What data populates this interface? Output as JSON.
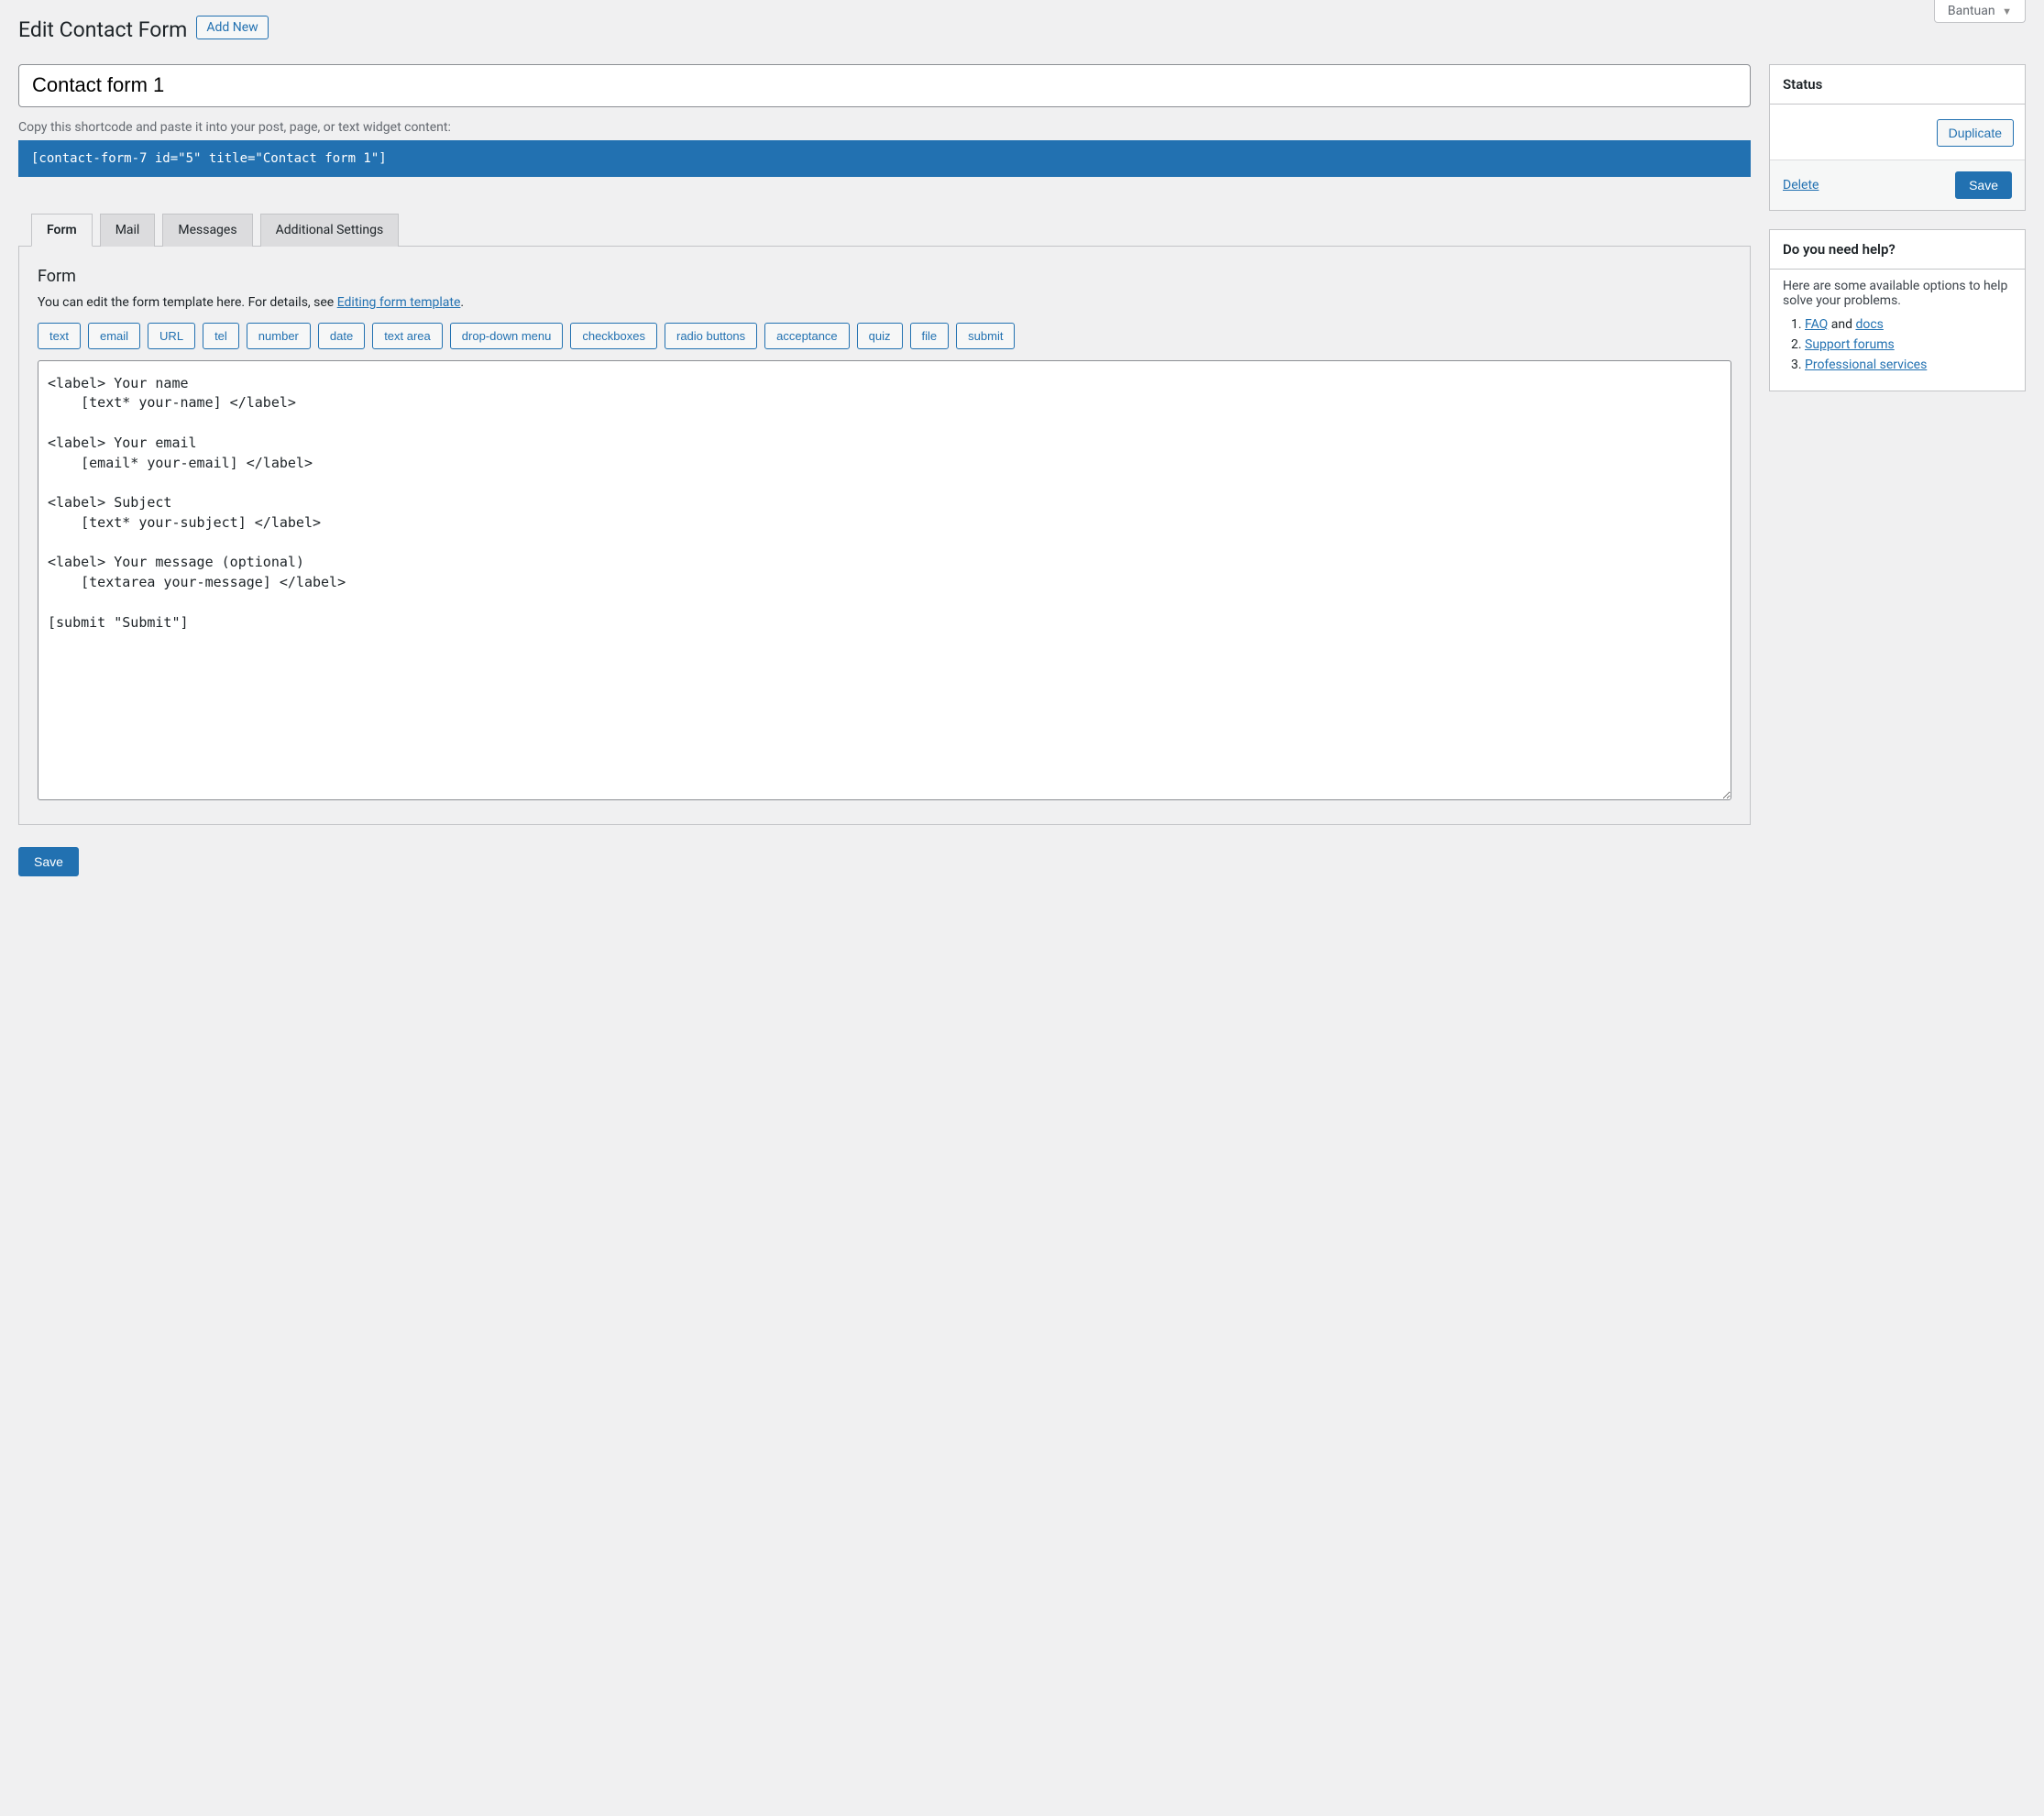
{
  "header": {
    "page_title": "Edit Contact Form",
    "add_new_label": "Add New",
    "help_toggle": "Bantuan"
  },
  "main": {
    "title_value": "Contact form 1",
    "shortcode_hint": "Copy this shortcode and paste it into your post, page, or text widget content:",
    "shortcode_value": "[contact-form-7 id=\"5\" title=\"Contact form 1\"]",
    "tabs": [
      {
        "label": "Form",
        "active": true
      },
      {
        "label": "Mail",
        "active": false
      },
      {
        "label": "Messages",
        "active": false
      },
      {
        "label": "Additional Settings",
        "active": false
      }
    ],
    "form_panel": {
      "heading": "Form",
      "desc_prefix": "You can edit the form template here. For details, see ",
      "desc_link": "Editing form template",
      "desc_suffix": ".",
      "tag_buttons": [
        "text",
        "email",
        "URL",
        "tel",
        "number",
        "date",
        "text area",
        "drop-down menu",
        "checkboxes",
        "radio buttons",
        "acceptance",
        "quiz",
        "file",
        "submit"
      ],
      "textarea_value": "<label> Your name\n    [text* your-name] </label>\n\n<label> Your email\n    [email* your-email] </label>\n\n<label> Subject\n    [text* your-subject] </label>\n\n<label> Your message (optional)\n    [textarea your-message] </label>\n\n[submit \"Submit\"]"
    },
    "save_bottom_label": "Save"
  },
  "sidebar": {
    "status": {
      "title": "Status",
      "duplicate_label": "Duplicate",
      "delete_label": "Delete",
      "save_label": "Save"
    },
    "help": {
      "title": "Do you need help?",
      "intro": "Here are some available options to help solve your problems.",
      "items": [
        {
          "prefix": "",
          "link": "FAQ",
          "mid": " and ",
          "link2": "docs",
          "suffix": ""
        },
        {
          "prefix": "",
          "link": "Support forums",
          "mid": "",
          "link2": "",
          "suffix": ""
        },
        {
          "prefix": "",
          "link": "Professional services",
          "mid": "",
          "link2": "",
          "suffix": ""
        }
      ]
    }
  }
}
